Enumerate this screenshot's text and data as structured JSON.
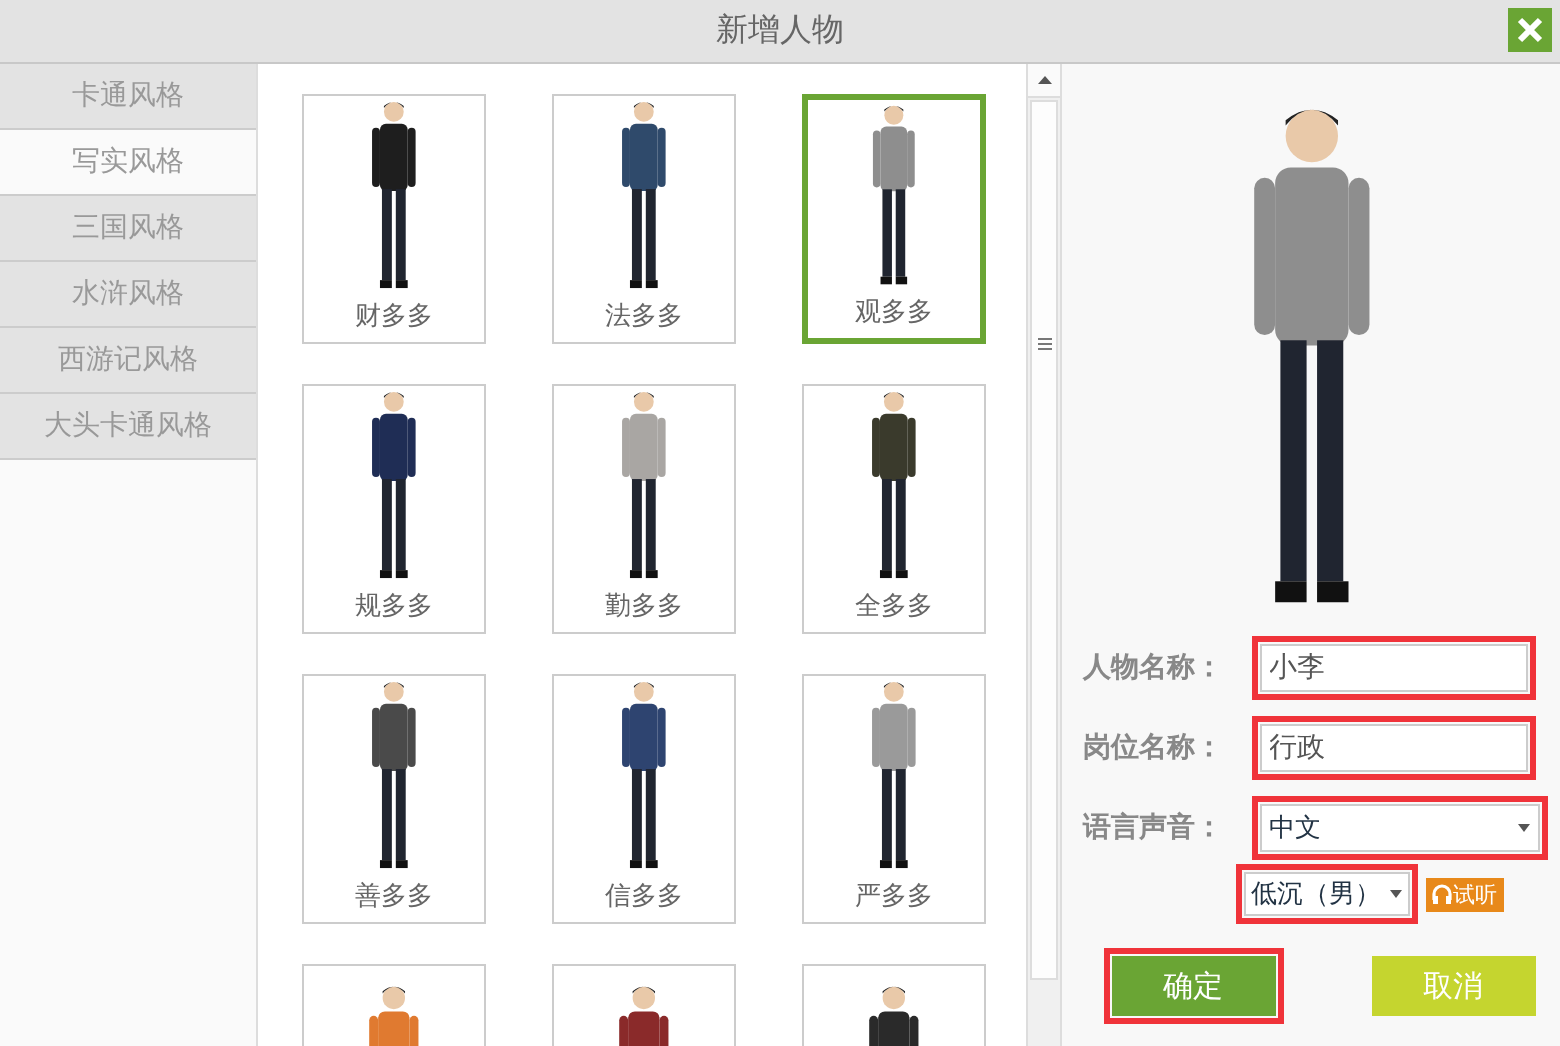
{
  "window": {
    "title": "新增人物"
  },
  "sidebar": {
    "items": [
      {
        "label": "卡通风格",
        "selected": false
      },
      {
        "label": "写实风格",
        "selected": true
      },
      {
        "label": "三国风格",
        "selected": false
      },
      {
        "label": "水浒风格",
        "selected": false
      },
      {
        "label": "西游记风格",
        "selected": false
      },
      {
        "label": "大头卡通风格",
        "selected": false
      }
    ]
  },
  "characters": [
    {
      "name": "财多多",
      "selected": false,
      "color": "#1e1e1e"
    },
    {
      "name": "法多多",
      "selected": false,
      "color": "#2f4a6b"
    },
    {
      "name": "观多多",
      "selected": true,
      "color": "#8e8e8e"
    },
    {
      "name": "规多多",
      "selected": false,
      "color": "#1f2d55"
    },
    {
      "name": "勤多多",
      "selected": false,
      "color": "#a9a6a3"
    },
    {
      "name": "全多多",
      "selected": false,
      "color": "#3a3a2c"
    },
    {
      "name": "善多多",
      "selected": false,
      "color": "#4a4a4a"
    },
    {
      "name": "信多多",
      "selected": false,
      "color": "#2e4470"
    },
    {
      "name": "严多多",
      "selected": false,
      "color": "#9a9a9a"
    },
    {
      "selected": false,
      "color": "#e07a30"
    },
    {
      "selected": false,
      "color": "#8a2a2a"
    },
    {
      "selected": false,
      "color": "#2a2a2a"
    }
  ],
  "form": {
    "fields": [
      {
        "kind": "text",
        "label": "人物名称：",
        "value": "小李",
        "highlighted": true
      },
      {
        "kind": "text",
        "label": "岗位名称：",
        "value": "行政",
        "highlighted": true
      },
      {
        "kind": "select",
        "label": "语言声音：",
        "value": "中文",
        "highlighted": true
      }
    ],
    "voice": {
      "value": "低沉（男）",
      "highlighted": true
    },
    "listen_button": "试听",
    "buttons": [
      {
        "label": "确定",
        "kind": "primary",
        "highlighted": true
      },
      {
        "label": "取消",
        "kind": "secondary",
        "highlighted": false
      }
    ]
  }
}
